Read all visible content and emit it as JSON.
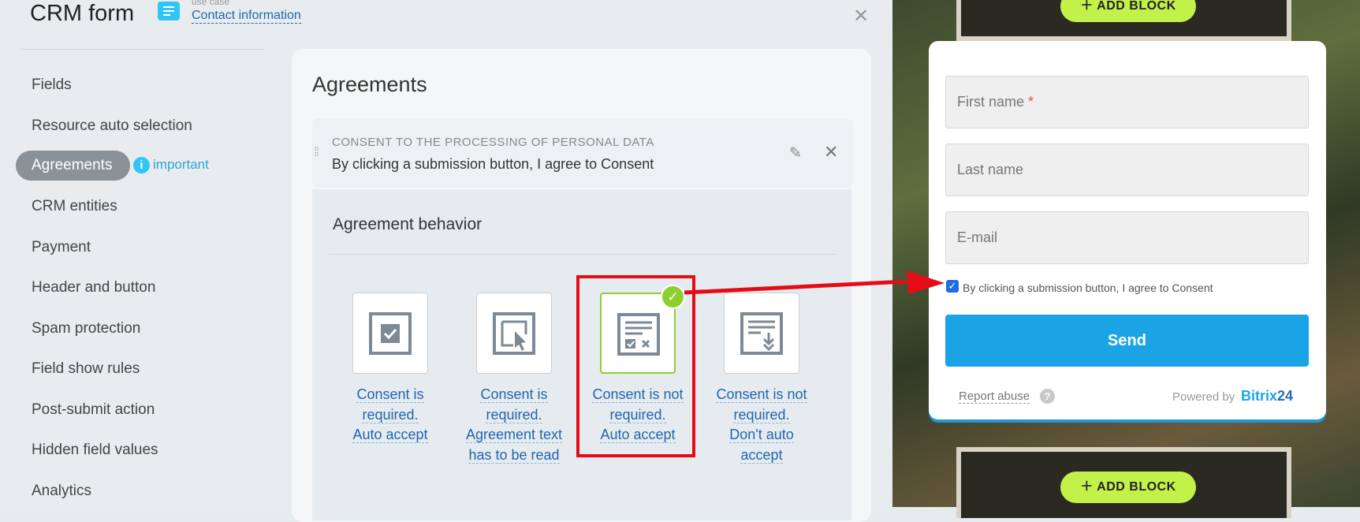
{
  "header": {
    "title": "CRM form",
    "use_case_label": "use case",
    "use_case_link": "Contact information"
  },
  "sidebar": {
    "items": [
      {
        "label": "Fields"
      },
      {
        "label": "Resource auto selection"
      },
      {
        "label": "Agreements",
        "active": true
      },
      {
        "label": "CRM entities"
      },
      {
        "label": "Payment"
      },
      {
        "label": "Header and button"
      },
      {
        "label": "Spam protection"
      },
      {
        "label": "Field show rules"
      },
      {
        "label": "Post-submit action"
      },
      {
        "label": "Hidden field values"
      },
      {
        "label": "Analytics"
      }
    ],
    "important_label": "important"
  },
  "agreements": {
    "title": "Agreements",
    "consent_caption": "CONSENT TO THE PROCESSING OF PERSONAL DATA",
    "consent_text": "By clicking a submission button, I agree to Consent",
    "behavior_title": "Agreement behavior",
    "options": [
      {
        "label_lines": [
          "Consent is",
          "required.",
          "Auto accept"
        ],
        "icon": "checkbox-icon",
        "selected": false
      },
      {
        "label_lines": [
          "Consent is",
          "required.",
          "Agreement text",
          "has to be read"
        ],
        "icon": "cursor-click-icon",
        "selected": false
      },
      {
        "label_lines": [
          "Consent is not",
          "required.",
          "Auto accept"
        ],
        "icon": "document-check-icon",
        "selected": true
      },
      {
        "label_lines": [
          "Consent is not",
          "required.",
          "Don't auto",
          "accept"
        ],
        "icon": "document-download-icon",
        "selected": false
      }
    ]
  },
  "preview": {
    "add_block_label": "ADD BLOCK",
    "fields": [
      {
        "placeholder": "First name",
        "required": true
      },
      {
        "placeholder": "Last name",
        "required": false
      },
      {
        "placeholder": "E-mail",
        "required": false
      }
    ],
    "required_mark": "*",
    "consent_checkbox_label": "By clicking a submission button, I agree to Consent",
    "send_label": "Send",
    "report_label": "Report abuse",
    "powered_label": "Powered by",
    "brand_name": "Bitrix",
    "brand_num": "24"
  },
  "colors": {
    "accent": "#2fc6f6",
    "send": "#1aa4e6",
    "selected_border": "#8fce2f",
    "highlight": "#e40d16",
    "add_block": "#c2f24a"
  }
}
